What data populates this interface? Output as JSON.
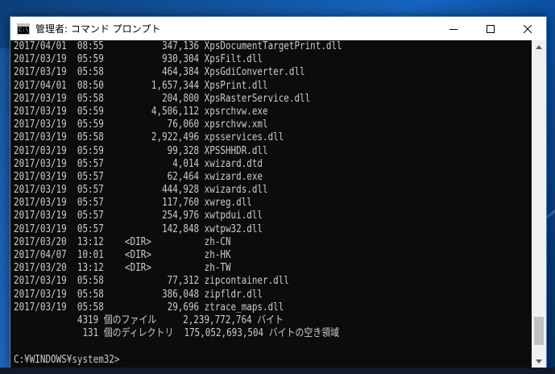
{
  "window": {
    "title": "管理者: コマンド プロンプト",
    "icon": "cmd-icon",
    "controls": {
      "minimize_icon": "minimize-icon",
      "maximize_icon": "maximize-icon",
      "close_icon": "close-icon"
    }
  },
  "console": {
    "lines": [
      "2017/04/01  08:55           347,136 XpsDocumentTargetPrint.dll",
      "2017/03/19  05:59           930,304 XpsFilt.dll",
      "2017/03/19  05:58           464,384 XpsGdiConverter.dll",
      "2017/04/01  08:50         1,657,344 XpsPrint.dll",
      "2017/03/19  05:58           204,800 XpsRasterService.dll",
      "2017/03/19  05:59         4,506,112 xpsrchvw.exe",
      "2017/03/19  05:59            76,060 xpsrchvw.xml",
      "2017/03/19  05:58         2,922,496 xpsservices.dll",
      "2017/03/19  05:59            99,328 XPSSHHDR.dll",
      "2017/03/19  05:57             4,014 xwizard.dtd",
      "2017/03/19  05:57            62,464 xwizard.exe",
      "2017/03/19  05:57           444,928 xwizards.dll",
      "2017/03/19  05:57           117,760 xwreg.dll",
      "2017/03/19  05:57           254,976 xwtpdui.dll",
      "2017/03/19  05:57           142,848 xwtpw32.dll",
      "2017/03/20  13:12    <DIR>          zh-CN",
      "2017/04/07  10:01    <DIR>          zh-HK",
      "2017/03/20  13:12    <DIR>          zh-TW",
      "2017/03/19  05:58            77,312 zipcontainer.dll",
      "2017/03/19  05:58           386,048 zipfldr.dll",
      "2017/03/19  05:58            29,696 ztrace_maps.dll",
      "            4319 個のファイル     2,239,772,764 バイト",
      "             131 個のディレクトリ  175,052,693,504 バイトの空き領域",
      "",
      "C:¥WINDOWS¥system32>"
    ]
  },
  "scrollbar": {
    "up_icon": "scroll-up-arrow-icon",
    "down_icon": "scroll-down-arrow-icon",
    "position_fraction": 0.97
  },
  "colors": {
    "console_background": "#0c0c0c",
    "console_text": "#cccccc",
    "titlebar_background": "#ffffff",
    "window_border": "#4a88c7",
    "desktop": "#1565c0"
  }
}
